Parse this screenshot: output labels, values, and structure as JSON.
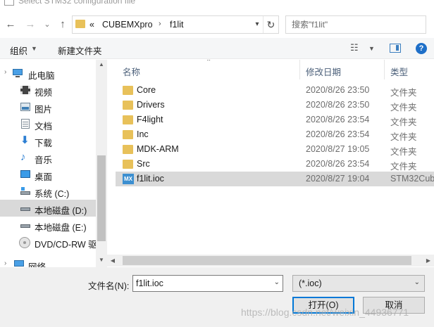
{
  "window": {
    "title": "Select STM32 configuration file"
  },
  "nav": {
    "back": "←",
    "forward": "→",
    "recent": "⌄",
    "up": "↑",
    "breadcrumb": {
      "overflow": "«",
      "items": [
        "CUBEMXpro",
        "f1lit"
      ],
      "separator": "›"
    },
    "refresh": "↻",
    "search_placeholder": "搜索\"f1lit\""
  },
  "toolbar": {
    "organize": "组织",
    "new_folder": "新建文件夹"
  },
  "sidebar": {
    "items": [
      {
        "label": "此电脑",
        "icon": "computer-icon"
      },
      {
        "label": "视频",
        "icon": "video-icon"
      },
      {
        "label": "图片",
        "icon": "picture-icon"
      },
      {
        "label": "文档",
        "icon": "document-icon"
      },
      {
        "label": "下载",
        "icon": "download-icon"
      },
      {
        "label": "音乐",
        "icon": "music-icon"
      },
      {
        "label": "桌面",
        "icon": "desktop-icon"
      },
      {
        "label": "系统 (C:)",
        "icon": "system-drive-icon"
      },
      {
        "label": "本地磁盘 (D:)",
        "icon": "drive-icon"
      },
      {
        "label": "本地磁盘 (E:)",
        "icon": "drive-icon"
      },
      {
        "label": "DVD/CD-RW 驱",
        "icon": "dvd-icon"
      },
      {
        "label": "网络",
        "icon": "network-icon"
      }
    ]
  },
  "columns": {
    "name": "名称",
    "modified": "修改日期",
    "type": "类型"
  },
  "files": [
    {
      "name": "Core",
      "date": "2020/8/26 23:50",
      "type": "文件夹",
      "kind": "folder"
    },
    {
      "name": "Drivers",
      "date": "2020/8/26 23:50",
      "type": "文件夹",
      "kind": "folder"
    },
    {
      "name": "F4light",
      "date": "2020/8/26 23:54",
      "type": "文件夹",
      "kind": "folder"
    },
    {
      "name": "Inc",
      "date": "2020/8/26 23:54",
      "type": "文件夹",
      "kind": "folder"
    },
    {
      "name": "MDK-ARM",
      "date": "2020/8/27 19:05",
      "type": "文件夹",
      "kind": "folder"
    },
    {
      "name": "Src",
      "date": "2020/8/26 23:54",
      "type": "文件夹",
      "kind": "folder"
    },
    {
      "name": "f1lit.ioc",
      "date": "2020/8/27 19:04",
      "type": "STM32Cub",
      "kind": "ioc",
      "icon_text": "MX"
    }
  ],
  "bottom": {
    "filename_label": "文件名(N):",
    "filename_value": "f1lit.ioc",
    "filetype": "(*.ioc)",
    "open_button": "打开(O)",
    "cancel_button": "取消"
  },
  "watermark": "https://blog.csdn.net/weixin_44936771",
  "colors": {
    "folder": "#e8c15a",
    "ioc_icon": "#3c8fd0",
    "selection": "#d9d9d9",
    "header_text": "#4c607a"
  }
}
